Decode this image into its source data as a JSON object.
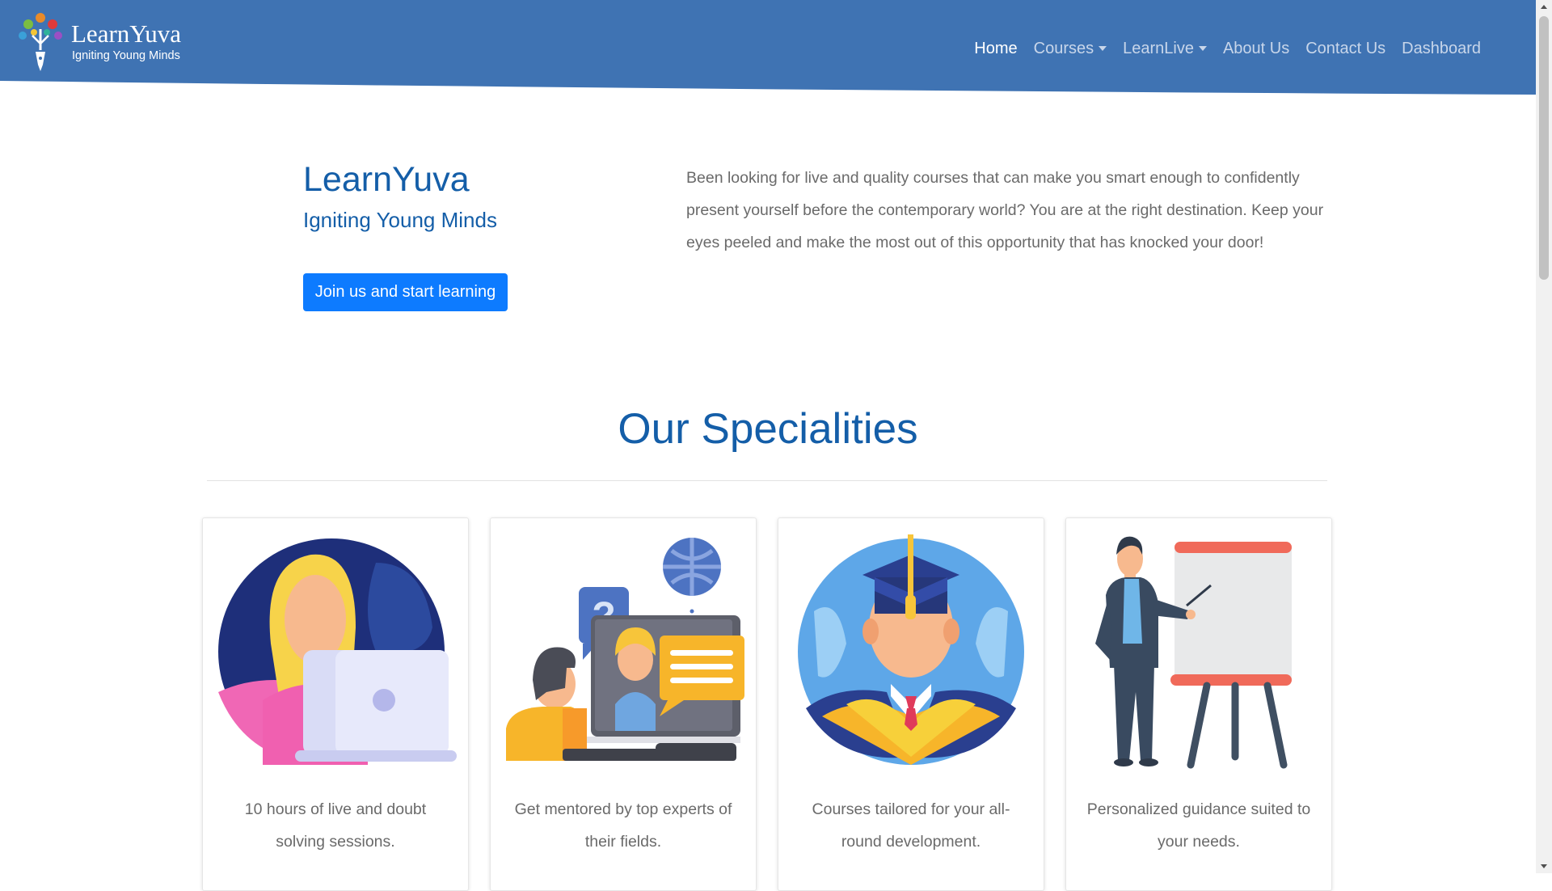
{
  "header": {
    "logo_name": "LearnYuva",
    "logo_tagline": "Igniting Young Minds",
    "nav": {
      "home": "Home",
      "courses": "Courses",
      "learnlive": "LearnLive",
      "about": "About Us",
      "contact": "Contact Us",
      "dashboard": "Dashboard"
    }
  },
  "hero": {
    "title": "LearnYuva",
    "subtitle": "Igniting Young Minds",
    "cta_label": "Join us and start learning",
    "description": "Been looking for live and quality courses that can make you smart enough to confidently present yourself before the contemporary world? You are at the right destination. Keep your eyes peeled and make the most out of this opportunity that has knocked your door!"
  },
  "specialities": {
    "title": "Our Specialities",
    "cards": [
      {
        "text": "10 hours of live and doubt solving sessions.",
        "icon": "student-laptop-illustration"
      },
      {
        "text": "Get mentored by top experts of their fields.",
        "icon": "online-mentoring-illustration"
      },
      {
        "text": "Courses tailored for your all-round development.",
        "icon": "graduate-illustration"
      },
      {
        "text": "Personalized guidance suited to your needs.",
        "icon": "presenter-whiteboard-illustration"
      }
    ]
  },
  "colors": {
    "header_bg": "#3f73b3",
    "brand_blue": "#145ea8",
    "cta_bg": "#0d7bff",
    "body_text": "#6a6a6a"
  }
}
